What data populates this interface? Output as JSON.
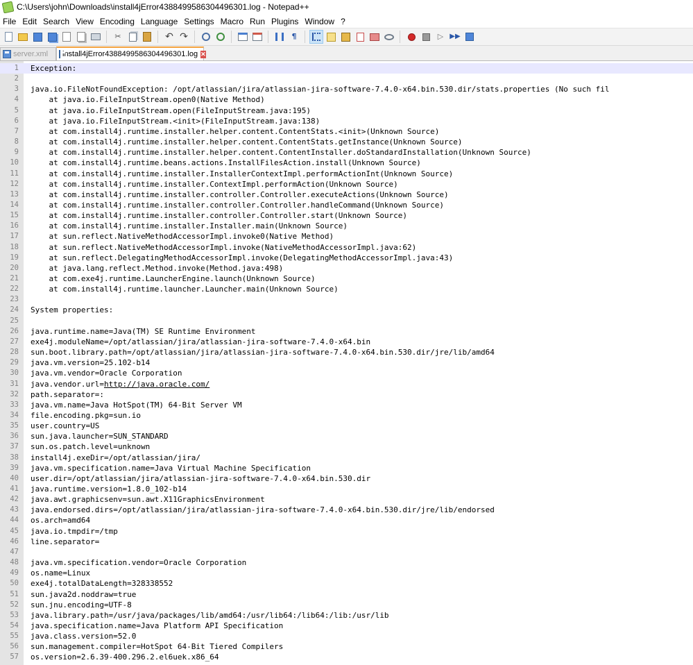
{
  "window": {
    "title": "C:\\Users\\john\\Downloads\\install4jError4388499586304496301.log - Notepad++"
  },
  "menu": [
    "File",
    "Edit",
    "Search",
    "View",
    "Encoding",
    "Language",
    "Settings",
    "Macro",
    "Run",
    "Plugins",
    "Window",
    "?"
  ],
  "toolbar": {
    "buttons": [
      "new-file",
      "open-file",
      "save",
      "save-all",
      "close",
      "close-all",
      "print",
      "cut",
      "copy",
      "paste",
      "undo",
      "redo",
      "find",
      "replace",
      "zoom-in",
      "zoom-out",
      "sync-vertical",
      "sync-horizontal",
      "word-wrap",
      "show-all-chars",
      "indent-guide",
      "user-language",
      "doc-map",
      "function-list",
      "folder-workspace",
      "monitoring",
      "record-macro",
      "stop-record",
      "play-macro",
      "play-multiple",
      "save-macro"
    ]
  },
  "tabs": [
    {
      "label": "server.xml",
      "active": false
    },
    {
      "label": "install4jError4388499586304496301.log",
      "active": true
    }
  ],
  "editor": {
    "lines": [
      "Exception:",
      "",
      "java.io.FileNotFoundException: /opt/atlassian/jira/atlassian-jira-software-7.4.0-x64.bin.530.dir/stats.properties (No such fil",
      "    at java.io.FileInputStream.open0(Native Method)",
      "    at java.io.FileInputStream.open(FileInputStream.java:195)",
      "    at java.io.FileInputStream.<init>(FileInputStream.java:138)",
      "    at com.install4j.runtime.installer.helper.content.ContentStats.<init>(Unknown Source)",
      "    at com.install4j.runtime.installer.helper.content.ContentStats.getInstance(Unknown Source)",
      "    at com.install4j.runtime.installer.helper.content.ContentInstaller.doStandardInstallation(Unknown Source)",
      "    at com.install4j.runtime.beans.actions.InstallFilesAction.install(Unknown Source)",
      "    at com.install4j.runtime.installer.InstallerContextImpl.performActionInt(Unknown Source)",
      "    at com.install4j.runtime.installer.ContextImpl.performAction(Unknown Source)",
      "    at com.install4j.runtime.installer.controller.Controller.executeActions(Unknown Source)",
      "    at com.install4j.runtime.installer.controller.Controller.handleCommand(Unknown Source)",
      "    at com.install4j.runtime.installer.controller.Controller.start(Unknown Source)",
      "    at com.install4j.runtime.installer.Installer.main(Unknown Source)",
      "    at sun.reflect.NativeMethodAccessorImpl.invoke0(Native Method)",
      "    at sun.reflect.NativeMethodAccessorImpl.invoke(NativeMethodAccessorImpl.java:62)",
      "    at sun.reflect.DelegatingMethodAccessorImpl.invoke(DelegatingMethodAccessorImpl.java:43)",
      "    at java.lang.reflect.Method.invoke(Method.java:498)",
      "    at com.exe4j.runtime.LauncherEngine.launch(Unknown Source)",
      "    at com.install4j.runtime.launcher.Launcher.main(Unknown Source)",
      "",
      "System properties:",
      "",
      "java.runtime.name=Java(TM) SE Runtime Environment",
      "exe4j.moduleName=/opt/atlassian/jira/atlassian-jira-software-7.4.0-x64.bin",
      "sun.boot.library.path=/opt/atlassian/jira/atlassian-jira-software-7.4.0-x64.bin.530.dir/jre/lib/amd64",
      "java.vm.version=25.102-b14",
      "java.vm.vendor=Oracle Corporation",
      "java.vendor.url=",
      "path.separator=:",
      "java.vm.name=Java HotSpot(TM) 64-Bit Server VM",
      "file.encoding.pkg=sun.io",
      "user.country=US",
      "sun.java.launcher=SUN_STANDARD",
      "sun.os.patch.level=unknown",
      "install4j.exeDir=/opt/atlassian/jira/",
      "java.vm.specification.name=Java Virtual Machine Specification",
      "user.dir=/opt/atlassian/jira/atlassian-jira-software-7.4.0-x64.bin.530.dir",
      "java.runtime.version=1.8.0_102-b14",
      "java.awt.graphicsenv=sun.awt.X11GraphicsEnvironment",
      "java.endorsed.dirs=/opt/atlassian/jira/atlassian-jira-software-7.4.0-x64.bin.530.dir/jre/lib/endorsed",
      "os.arch=amd64",
      "java.io.tmpdir=/tmp",
      "line.separator=",
      "",
      "java.vm.specification.vendor=Oracle Corporation",
      "os.name=Linux",
      "exe4j.totalDataLength=328338552",
      "sun.java2d.noddraw=true",
      "sun.jnu.encoding=UTF-8",
      "java.library.path=/usr/java/packages/lib/amd64:/usr/lib64:/lib64:/lib:/usr/lib",
      "java.specification.name=Java Platform API Specification",
      "java.class.version=52.0",
      "sun.management.compiler=HotSpot 64-Bit Tiered Compilers",
      "os.version=2.6.39-400.296.2.el6uek.x86_64"
    ],
    "link_line": 31,
    "link_text": "http://java.oracle.com/"
  }
}
